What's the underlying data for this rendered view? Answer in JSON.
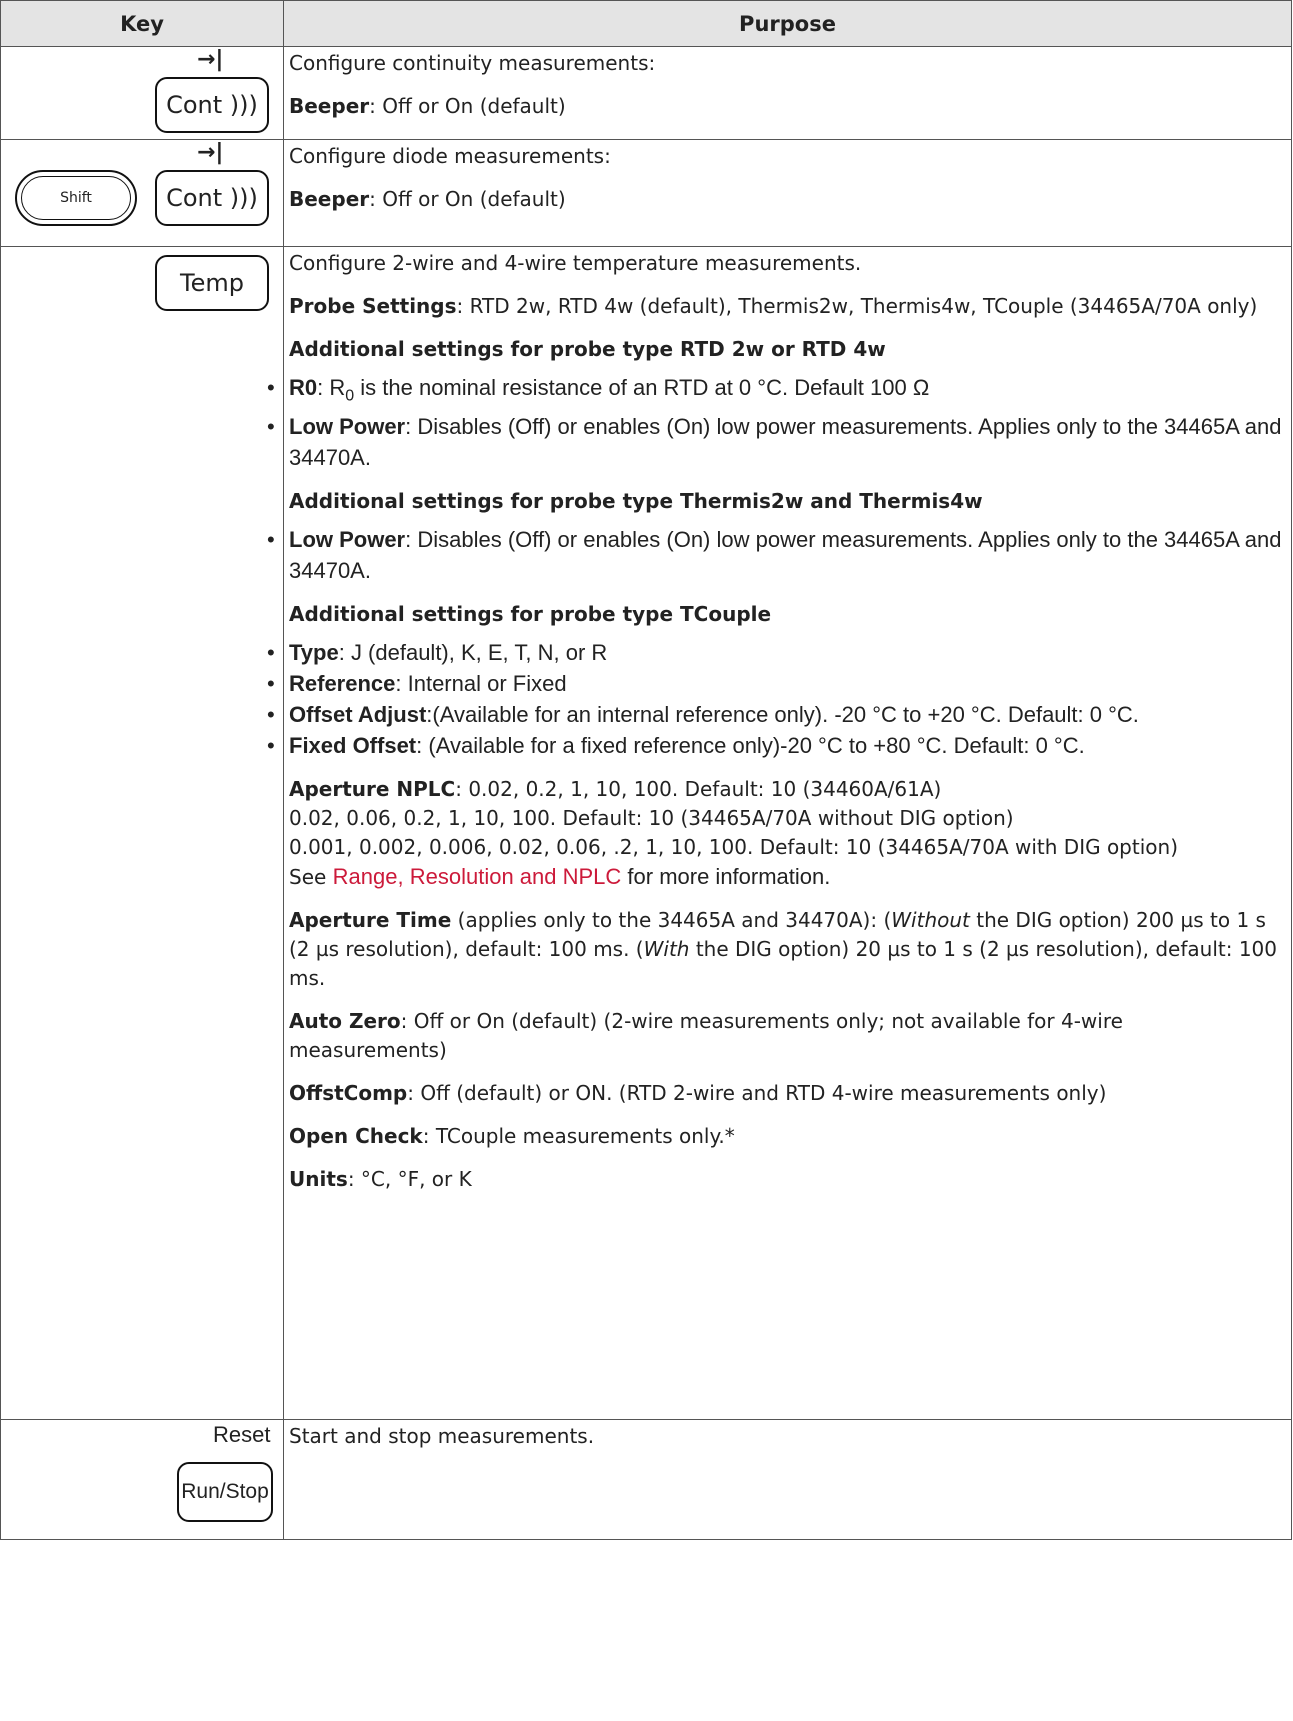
{
  "header": {
    "key": "Key",
    "purpose": "Purpose"
  },
  "rows": {
    "cont": {
      "key_symbol": "→|",
      "key_label": "Cont",
      "desc": "Configure continuity measurements:",
      "beeper_label": "Beeper",
      "beeper_text": ": Off or On (default)"
    },
    "diode": {
      "key_symbol": "→|",
      "shift_label": "Shift",
      "key_label": "Cont",
      "desc": "Configure diode measurements:",
      "beeper_label": "Beeper",
      "beeper_text": ": Off or On (default)"
    },
    "temp": {
      "key_label": "Temp",
      "desc": "Configure 2-wire and 4-wire temperature measurements.",
      "probe_label": "Probe Settings",
      "probe_text": ": RTD 2w, RTD 4w (default), Thermis2w, Thermis4w, TCouple (34465A/70A only)",
      "rtd_heading": "Additional settings for probe type RTD 2w or RTD 4w",
      "rtd_r0_label": "R0",
      "rtd_r0_pre": ": R",
      "rtd_r0_sub": "0",
      "rtd_r0_text": " is the nominal resistance of an RTD at 0 °C. Default 100 Ω",
      "rtd_lp_label": "Low Power",
      "rtd_lp_text": ": Disables (Off) or enables (On) low power measurements. Applies only to the 34465A and 34470A.",
      "therm_heading": "Additional settings for probe type Thermis2w and Thermis4w",
      "therm_lp_label": "Low Power",
      "therm_lp_text": ": Disables (Off) or enables (On) low power measurements. Applies only to the 34465A and 34470A.",
      "tc_heading": "Additional settings for probe type TCouple",
      "tc_type_label": "Type",
      "tc_type_text": ": J (default), K, E, T, N, or R",
      "tc_ref_label": "Reference",
      "tc_ref_text": ": Internal or Fixed",
      "tc_off_label": "Offset Adjust",
      "tc_off_text": ":(Available for an internal reference only). -20 °C to +20 °C. Default: 0 °C.",
      "tc_fix_label": "Fixed Offset",
      "tc_fix_text": ": (Available for a fixed reference only)-20 °C to +80 °C. Default: 0 °C.",
      "nplc_label": "Aperture NPLC",
      "nplc_line1": ": 0.02, 0.2, 1, 10, 100. Default: 10 (34460A/61A)",
      "nplc_line2": "0.02, 0.06, 0.2, 1, 10, 100. Default: 10 (34465A/70A without DIG option)",
      "nplc_line3": "0.001, 0.002, 0.006, 0.02, 0.06, .2, 1, 10, 100. Default: 10 (34465A/70A with DIG option)",
      "nplc_see": "See ",
      "nplc_link": "Range, Resolution and NPLC",
      "nplc_more": " for more information.",
      "atime_label": "Aperture Time",
      "atime_t1": " (applies only to the 34465A and 34470A): (",
      "atime_without": "Without",
      "atime_t2": " the DIG option) 200 µs to 1 s (2 µs resolution), default: 100 ms. (",
      "atime_with": "With",
      "atime_t3": " the DIG option) 20 µs to 1 s (2 µs resolution), default: 100 ms.",
      "az_label": "Auto Zero",
      "az_text": ": Off or On (default) (2-wire measurements only; not available for 4-wire measurements)",
      "oc_label": "OffstComp",
      "oc_text": ": Off (default) or ON. (RTD 2-wire and RTD 4-wire measurements only)",
      "open_label": "Open Check",
      "open_text": ": TCouple measurements only.*",
      "units_label": "Units",
      "units_text": ": °C, °F, or K"
    },
    "run": {
      "over_label": "Reset",
      "key_label": "Run/Stop",
      "desc": "Start and stop measurements."
    }
  }
}
